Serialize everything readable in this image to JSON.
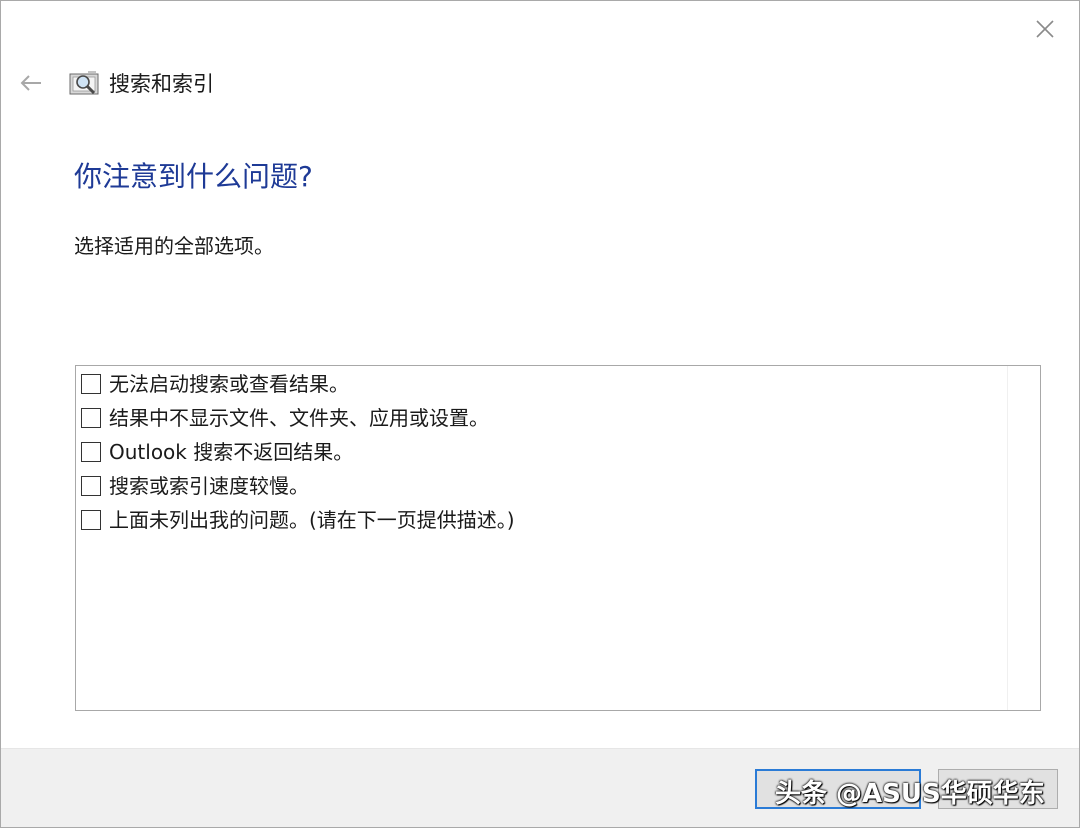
{
  "window": {
    "app_title": "搜索和索引",
    "close_icon": "close-icon",
    "back_icon": "back-arrow-icon",
    "app_icon": "search-indexing-icon"
  },
  "main": {
    "heading": "你注意到什么问题?",
    "instruction": "选择适用的全部选项。",
    "options": [
      {
        "label": "无法启动搜索或查看结果。",
        "checked": false
      },
      {
        "label": "结果中不显示文件、文件夹、应用或设置。",
        "checked": false
      },
      {
        "label": "Outlook 搜索不返回结果。",
        "checked": false
      },
      {
        "label": "搜索或索引速度较慢。",
        "checked": false
      },
      {
        "label": "上面未列出我的问题。(请在下一页提供描述。)",
        "checked": false
      }
    ]
  },
  "footer": {
    "next_label": "",
    "cancel_label": ""
  },
  "watermark": {
    "text": "头条 @ASUS华硕华东"
  },
  "colors": {
    "heading": "#1e3a96",
    "focus_border": "#2a7bd6",
    "footer_bg": "#f0f0f0"
  }
}
